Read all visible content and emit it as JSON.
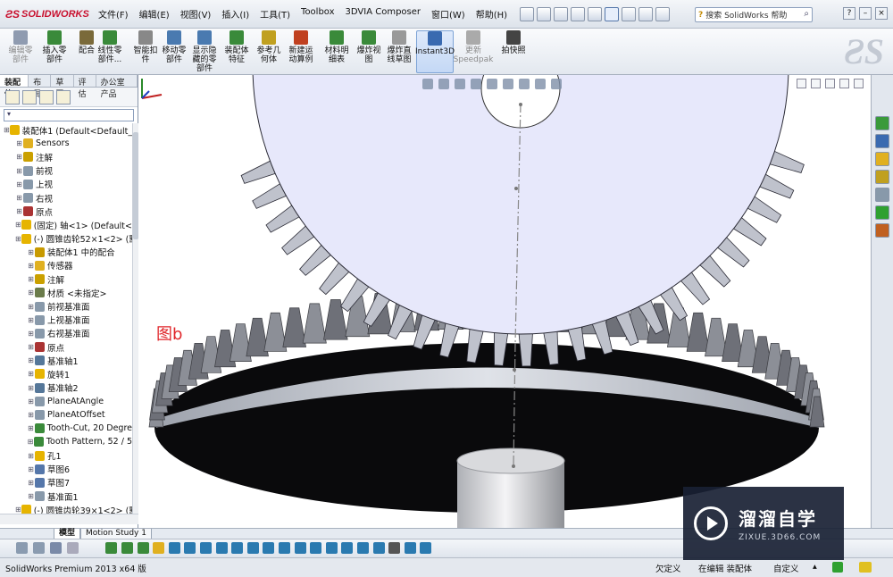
{
  "menubar": {
    "logo": "SOLIDWORKS",
    "items": [
      "文件(F)",
      "编辑(E)",
      "视图(V)",
      "插入(I)",
      "工具(T)",
      "Toolbox",
      "3DVIA Composer",
      "窗口(W)",
      "帮助(H)"
    ],
    "search_placeholder": "搜索 SolidWorks 帮助"
  },
  "commands": [
    {
      "label": "编辑零\n部件",
      "enabled": false
    },
    {
      "label": "插入零\n部件",
      "enabled": true
    },
    {
      "label": "配合",
      "enabled": true
    },
    {
      "label": "线性零\n部件...",
      "enabled": true
    },
    {
      "label": "智能扣\n件",
      "enabled": true
    },
    {
      "label": "移动零\n部件",
      "enabled": true
    },
    {
      "label": "显示隐\n藏的零\n部件",
      "enabled": true
    },
    {
      "label": "装配体\n特征",
      "enabled": true
    },
    {
      "label": "参考几\n何体",
      "enabled": true
    },
    {
      "label": "新建运\n动算例",
      "enabled": true
    },
    {
      "label": "材料明\n细表",
      "enabled": true
    },
    {
      "label": "爆炸视\n图",
      "enabled": true
    },
    {
      "label": "爆炸直\n线草图",
      "enabled": true
    },
    {
      "label": "Instant3D",
      "enabled": true
    },
    {
      "label": "更新\nSpeedpak",
      "enabled": false
    },
    {
      "label": "拍快照",
      "enabled": true
    }
  ],
  "panel_tabs": [
    "装配体",
    "布局",
    "草图",
    "评估",
    "办公室产品"
  ],
  "tree": [
    {
      "indent": 0,
      "text": "装配体1  (Default<Default_D",
      "color": "#e6b400"
    },
    {
      "indent": 1,
      "text": "Sensors",
      "color": "#e0b020"
    },
    {
      "indent": 1,
      "text": "注解",
      "color": "#caa000"
    },
    {
      "indent": 1,
      "text": "前视",
      "color": "#8899aa"
    },
    {
      "indent": 1,
      "text": "上视",
      "color": "#8899aa"
    },
    {
      "indent": 1,
      "text": "右视",
      "color": "#8899aa"
    },
    {
      "indent": 1,
      "text": "原点",
      "color": "#aa3333"
    },
    {
      "indent": 1,
      "text": "(固定) 轴<1> (Default<<",
      "color": "#e6b400"
    },
    {
      "indent": 1,
      "text": "(-) 圆锥齿轮52×1<2> (默",
      "color": "#e6b400"
    },
    {
      "indent": 2,
      "text": "装配体1 中的配合",
      "color": "#c89a00"
    },
    {
      "indent": 2,
      "text": "传感器",
      "color": "#e0b020"
    },
    {
      "indent": 2,
      "text": "注解",
      "color": "#caa000"
    },
    {
      "indent": 2,
      "text": "材质 <未指定>",
      "color": "#6a7b4a"
    },
    {
      "indent": 2,
      "text": "前视基准面",
      "color": "#8899aa"
    },
    {
      "indent": 2,
      "text": "上视基准面",
      "color": "#8899aa"
    },
    {
      "indent": 2,
      "text": "右视基准面",
      "color": "#8899aa"
    },
    {
      "indent": 2,
      "text": "原点",
      "color": "#aa3333"
    },
    {
      "indent": 2,
      "text": "基准轴1",
      "color": "#557799"
    },
    {
      "indent": 2,
      "text": "旋转1",
      "color": "#e6b400"
    },
    {
      "indent": 2,
      "text": "基准轴2",
      "color": "#557799"
    },
    {
      "indent": 2,
      "text": "PlaneAtAngle",
      "color": "#8899aa"
    },
    {
      "indent": 2,
      "text": "PlaneAtOffset",
      "color": "#8899aa"
    },
    {
      "indent": 2,
      "text": "Tooth-Cut, 20 Degre",
      "color": "#3a8a3a"
    },
    {
      "indent": 2,
      "text": "Tooth Pattern, 52 / 5",
      "color": "#3a8a3a"
    },
    {
      "indent": 2,
      "text": "孔1",
      "color": "#e6b400"
    },
    {
      "indent": 2,
      "text": "草图6",
      "color": "#5577aa"
    },
    {
      "indent": 2,
      "text": "草图7",
      "color": "#5577aa"
    },
    {
      "indent": 2,
      "text": "基准面1",
      "color": "#8899aa"
    },
    {
      "indent": 1,
      "text": "(-) 圆锥齿轮39×1<2> (默",
      "color": "#e6b400"
    }
  ],
  "viewport": {
    "annotation": "图b"
  },
  "bottom_tabs": [
    "模型",
    "Motion Study 1"
  ],
  "status": {
    "product": "SolidWorks Premium 2013 x64 版",
    "underdefined": "欠定义",
    "editing": "在编辑 装配体",
    "custom": "自定义"
  },
  "watermark": {
    "title": "溜溜自学",
    "url": "ZIXUE.3D66.COM"
  }
}
